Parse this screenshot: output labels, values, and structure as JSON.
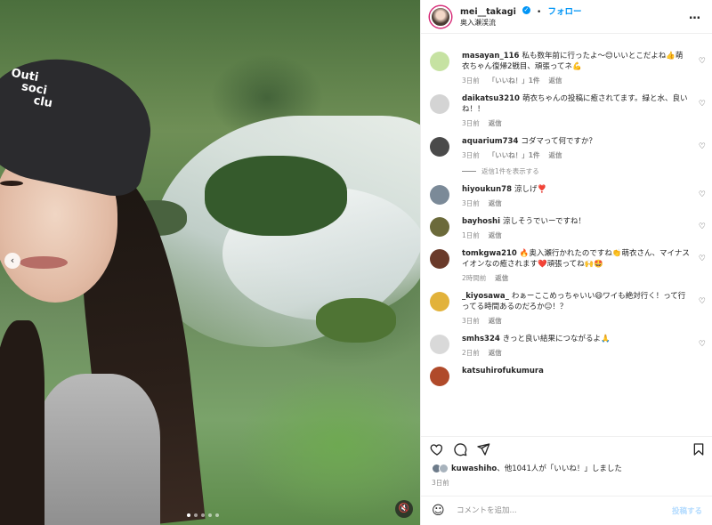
{
  "photo": {
    "cap_text_lines": [
      "Outi",
      "soci",
      "clu"
    ],
    "nav_prev_icon": "chevron-left-icon",
    "nav_prev_glyph": "‹",
    "mute_icon": "speaker-muted-icon",
    "mute_glyph": "🔇",
    "carousel_dots": 5,
    "carousel_active": 1
  },
  "header": {
    "username": "mei__takagi",
    "verified_glyph": "✓",
    "separator": "•",
    "follow_label": "フォロー",
    "location": "奥入瀬渓流",
    "more_glyph": "…"
  },
  "comments": [
    {
      "user": "masayan_116",
      "text": "私も数年前に行ったよ〜😊いいとこだよね👍萌衣ちゃん復帰2戦目、頑張ってネ💪",
      "time": "3日前",
      "likes": "「いいね！」1件",
      "reply": "返信",
      "avatar_color": "#c6e2a2"
    },
    {
      "user": "daikatsu3210",
      "text": "萌衣ちゃんの投稿に癒されてます。緑と水、良いね！！",
      "time": "3日前",
      "likes": "",
      "reply": "返信",
      "avatar_color": "#d4d4d4"
    },
    {
      "user": "aquarium734",
      "text": "コダマって何ですか？",
      "time": "3日前",
      "likes": "「いいね！」1件",
      "reply": "返信",
      "avatar_color": "#4a4a4a"
    },
    {
      "user": "hiyoukun78",
      "text": "涼しげ❣️",
      "time": "3日前",
      "likes": "",
      "reply": "返信",
      "avatar_color": "#7b8a98"
    },
    {
      "user": "bayhoshi",
      "text": "涼しそうでいーですね！",
      "time": "1日前",
      "likes": "",
      "reply": "返信",
      "avatar_color": "#6b6a3a"
    },
    {
      "user": "tomkgwa210",
      "text": "🔥奥入瀬行かれたのですね👏萌衣さん、マイナスイオンなの癒されます❤️頑張ってね🙌🤩",
      "time": "2時間前",
      "likes": "",
      "reply": "返信",
      "avatar_color": "#6a3a2a"
    },
    {
      "user": "_kiyosawa_",
      "text": "わぁーここめっちゃいい😄ワイも絶対行く！って行ってる時間あるのだろか😑！？",
      "time": "3日前",
      "likes": "",
      "reply": "返信",
      "avatar_color": "#e2b23a"
    },
    {
      "user": "smhs324",
      "text": "きっと良い結果につながるよ🙏",
      "time": "2日前",
      "likes": "",
      "reply": "返信",
      "avatar_color": "#d9d9d9"
    },
    {
      "user": "katsuhirofukumura",
      "text": "",
      "time": "",
      "likes": "",
      "reply": "",
      "avatar_color": "#b04a2a"
    }
  ],
  "view_replies": "返信1件を表示する",
  "actions": {
    "like_icon": "heart-icon",
    "comment_icon": "comment-icon",
    "share_icon": "share-icon",
    "save_icon": "bookmark-icon"
  },
  "likes": {
    "user": "kuwashiho",
    "rest": "、他1041人が「いいね！」しました"
  },
  "post_date": "3日前",
  "add_comment": {
    "emoji_icon": "emoji-icon",
    "placeholder": "コメントを追加...",
    "post_label": "投稿する"
  }
}
